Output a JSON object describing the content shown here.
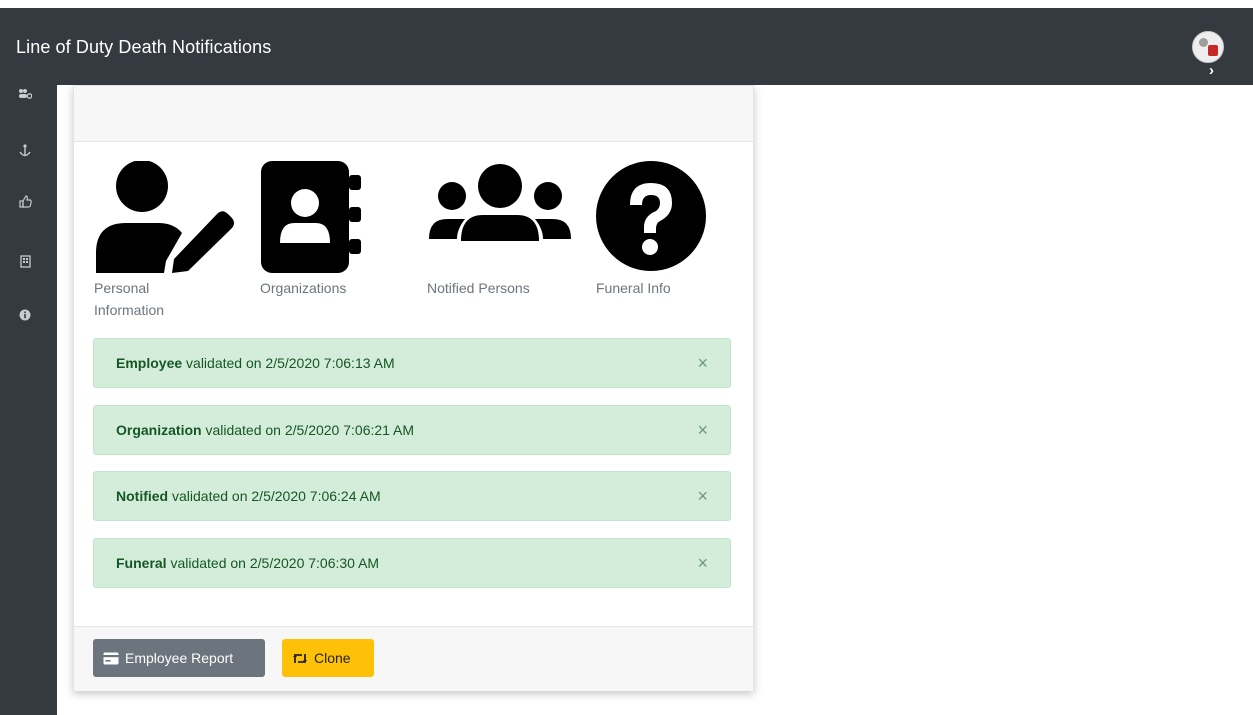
{
  "header": {
    "title": "Line of Duty Death Notifications"
  },
  "sidebar": {
    "icons": [
      "users-cog-icon",
      "anchor-icon",
      "thumbs-up-icon",
      "building-icon",
      "info-circle-icon"
    ]
  },
  "steps": [
    {
      "label_line1": "Personal",
      "label_line2": "Information",
      "icon": "user-edit-icon"
    },
    {
      "label_line1": "Organizations",
      "icon": "address-book-icon"
    },
    {
      "label_line1": "Notified Persons",
      "icon": "users-icon"
    },
    {
      "label_line1": "Funeral Info",
      "icon": "question-circle-icon"
    }
  ],
  "alerts": [
    {
      "strong": "Employee",
      "text": " validated on 2/5/2020 7:06:13 AM",
      "close": "×"
    },
    {
      "strong": "Organization",
      "text": " validated on 2/5/2020 7:06:21 AM",
      "close": "×"
    },
    {
      "strong": "Notified",
      "text": " validated on 2/5/2020 7:06:24 AM",
      "close": "×"
    },
    {
      "strong": "Funeral",
      "text": " validated on 2/5/2020 7:06:30 AM",
      "close": "×"
    }
  ],
  "footer": {
    "report_label": "Employee Report",
    "clone_label": "Clone"
  },
  "colors": {
    "topbar": "#343a40",
    "alert_bg": "#d4edda",
    "alert_text": "#155724",
    "btn_secondary": "#6c757d",
    "btn_warning": "#ffc107"
  }
}
